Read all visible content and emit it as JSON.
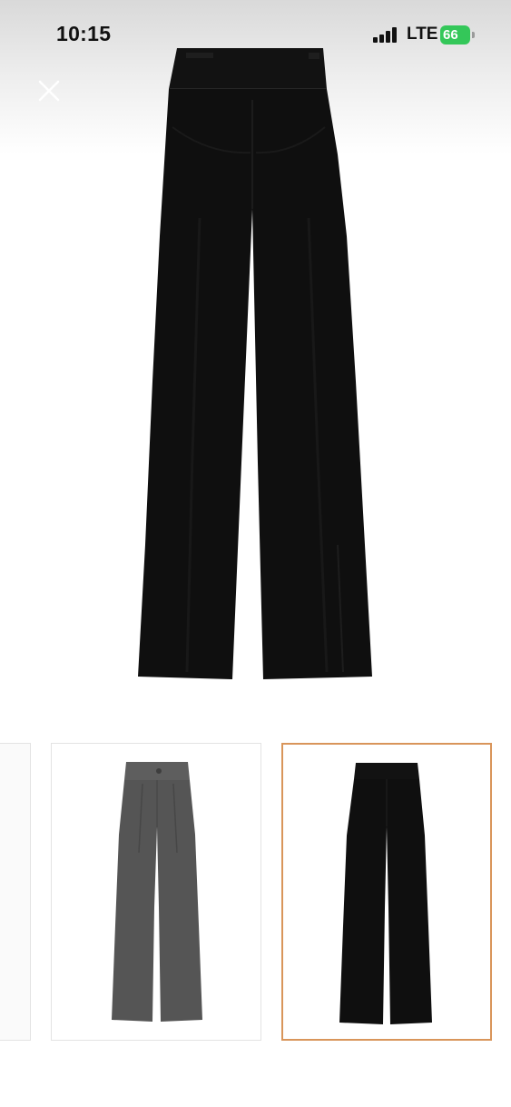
{
  "status_bar": {
    "time": "10:15",
    "network": "LTE",
    "battery_level": "66",
    "battery_color": "#34c759"
  },
  "toolbar": {
    "close_icon": "close-icon"
  },
  "product_gallery": {
    "main_image": "black-trousers-back-view",
    "thumbnails": [
      {
        "image": "trousers-partial-view",
        "selected": false
      },
      {
        "image": "grey-pleated-trousers-front-view",
        "selected": false
      },
      {
        "image": "black-trousers-back-view",
        "selected": true
      }
    ],
    "selected_border_color": "#d9955a"
  }
}
